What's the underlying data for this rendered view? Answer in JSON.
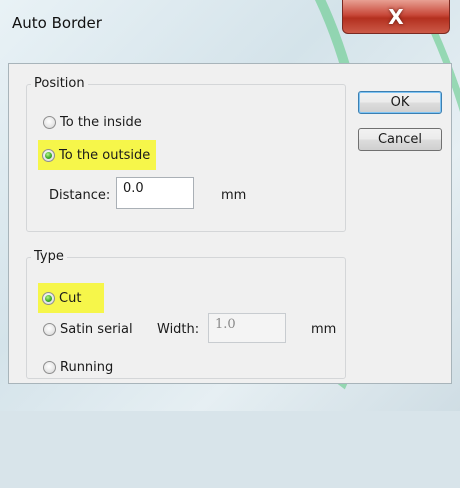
{
  "window": {
    "title": "Auto Border",
    "close_glyph": "X",
    "close_icon": "close-icon"
  },
  "position_group": {
    "label": "Position",
    "options": [
      {
        "label": "To the inside",
        "selected": false,
        "highlighted": false
      },
      {
        "label": "To the outside",
        "selected": true,
        "highlighted": true
      }
    ],
    "distance_label": "Distance:",
    "distance_value": "0.0",
    "distance_unit": "mm"
  },
  "type_group": {
    "label": "Type",
    "options": [
      {
        "label": "Cut",
        "selected": true,
        "highlighted": true
      },
      {
        "label": "Satin serial",
        "selected": false,
        "highlighted": false
      },
      {
        "label": "Running",
        "selected": false,
        "highlighted": false
      }
    ],
    "width_label": "Width:",
    "width_value": "1.0",
    "width_unit": "mm"
  },
  "buttons": {
    "ok_label": "OK",
    "cancel_label": "Cancel"
  },
  "colors": {
    "highlight": "#f6f64a",
    "close_button": "#c8493a",
    "radio_selected": "#3fae2a"
  }
}
